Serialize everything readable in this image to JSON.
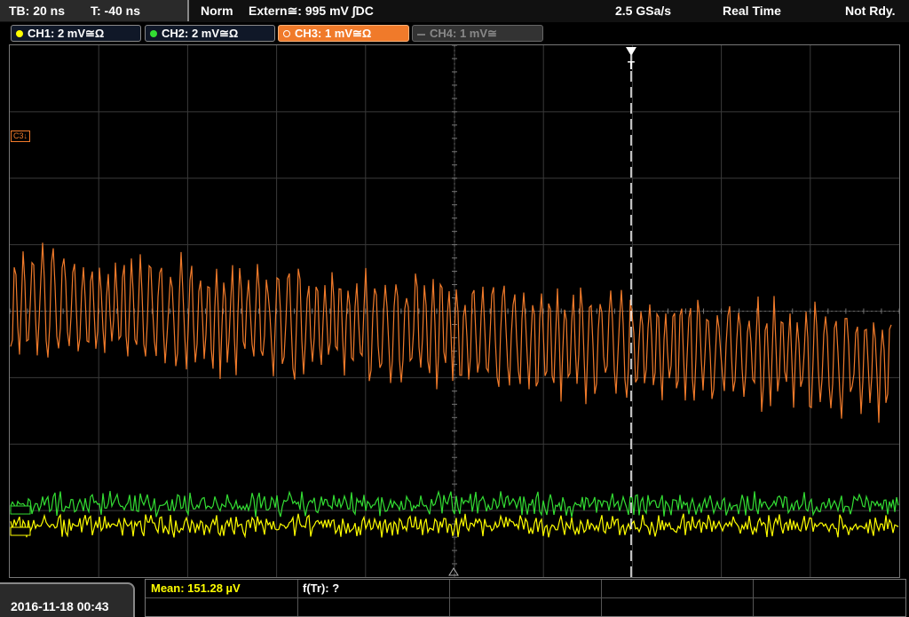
{
  "topbar": {
    "timebase": "TB: 20 ns",
    "trigger_offset": "T: -40 ns",
    "trigger_mode": "Norm",
    "trigger_source": "Extern≅: 995 mV ∫DC",
    "sample_rate": "2.5 GSa/s",
    "acq_mode": "Real Time",
    "status": "Not Rdy."
  },
  "channels": [
    {
      "label": "CH1: 2 mV≅Ω",
      "color": "#ffff00",
      "active": true
    },
    {
      "label": "CH2: 2 mV≅Ω",
      "color": "#33dd33",
      "active": true
    },
    {
      "label": "CH3: 1 mV≅Ω",
      "color": "#f07a2a",
      "active": true
    },
    {
      "label": "CH4: 1 mV≅",
      "color": "#777777",
      "active": false
    }
  ],
  "markers": {
    "c3": "C3",
    "trigger": "T"
  },
  "statusbar": {
    "datetime": "2016-11-18 00:43",
    "mean": "Mean: 151.28 µV",
    "ftr": "f(Tr): ?"
  },
  "colors": {
    "ch1": "#ffff00",
    "ch2": "#33dd33",
    "ch3": "#f07a2a",
    "grid": "#3a3a3a"
  }
}
